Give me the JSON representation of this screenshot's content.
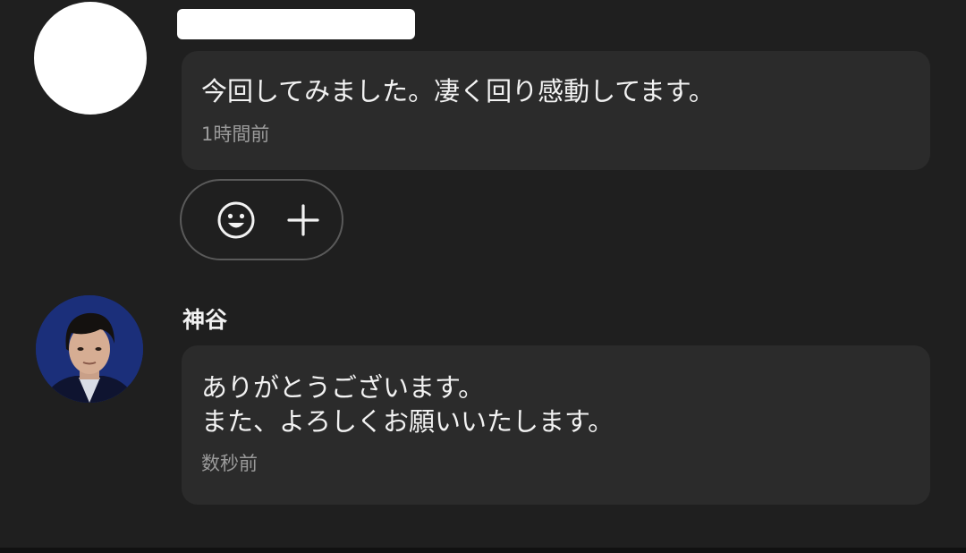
{
  "comments": [
    {
      "author": "",
      "author_redacted": true,
      "message_lines": [
        "今回してみました。凄く回り感動してます。"
      ],
      "timestamp": "1時間前",
      "reactions": {
        "add_emoji_icon": "smiley-face-icon",
        "add_icon": "plus-icon"
      }
    },
    {
      "author": "神谷",
      "avatar": "user-photo",
      "message_lines": [
        "ありがとうございます。",
        "また、よろしくお願いいたします。"
      ],
      "timestamp": "数秒前"
    }
  ],
  "colors": {
    "background": "#1f1f1f",
    "bubble": "#2b2b2b",
    "text": "#f2f2f2",
    "muted_text": "#9a9a9a",
    "pill_border": "#5a5a5a",
    "avatar_bg": "#1b2f7a"
  }
}
